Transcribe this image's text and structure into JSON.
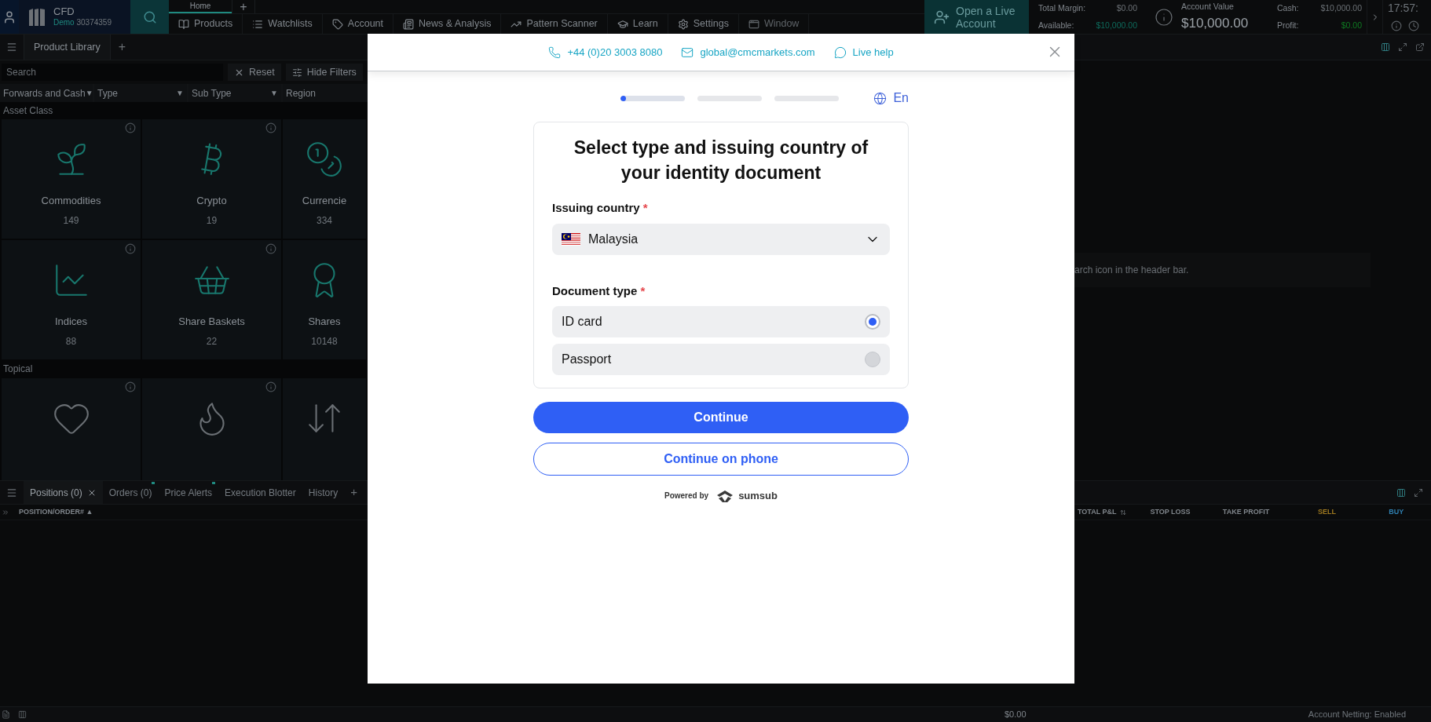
{
  "top_bar": {
    "account_type": "CFD",
    "account_label": "Demo",
    "account_number": "30374359",
    "tabs": [
      {
        "label": "Home",
        "selected": true
      }
    ],
    "add_tab": "+",
    "nav": [
      "Products",
      "Watchlists",
      "Account",
      "News & Analysis",
      "Pattern Scanner",
      "Learn",
      "Settings",
      "Window"
    ],
    "live_account": "Open a Live Account",
    "stats": [
      {
        "label": "Total Margin:",
        "value": "$0.00",
        "color": "#6b7075"
      },
      {
        "label": "Available:",
        "value": "$10,000.00",
        "color": "#0e6b5c"
      }
    ],
    "account_value": {
      "label": "Account Value",
      "value": "$10,000.00"
    },
    "balances": [
      {
        "label": "Cash:",
        "value": "$10,000.00",
        "color": "#6b7075"
      },
      {
        "label": "Profit:",
        "value": "$0.00",
        "color": "#0f7a22"
      }
    ],
    "clock": "17:57:"
  },
  "product_library": {
    "tab": "Product Library",
    "add_tab": "+",
    "search": {
      "placeholder": "Search"
    },
    "reset": "Reset",
    "hide_filters": "Hide Filters",
    "filters": [
      {
        "label": "Forwards and Cash",
        "arrow": "▼"
      },
      {
        "label": "Type",
        "arrow": "▼"
      },
      {
        "label": "Sub Type",
        "arrow": "▼"
      },
      {
        "label": "Region"
      }
    ],
    "asset_class": {
      "label": "Asset Class",
      "tiles": [
        {
          "name": "Commodities",
          "count": "149",
          "info": true
        },
        {
          "name": "Crypto",
          "count": "19",
          "info": true
        },
        {
          "name": "Currencie",
          "count": "334",
          "info": false
        },
        {
          "name": "Indices",
          "count": "88",
          "info": true
        },
        {
          "name": "Share Baskets",
          "count": "22",
          "info": true
        },
        {
          "name": "Shares",
          "count": "10148",
          "info": false
        }
      ]
    },
    "topical": {
      "label": "Topical",
      "tiles": [
        {
          "info": true
        },
        {
          "info": true
        },
        {
          "info": false
        }
      ]
    }
  },
  "right_panel": {
    "message": "arch icon in the header bar."
  },
  "positions_panel": {
    "tabs": [
      {
        "label": "Positions (0)",
        "selected": true,
        "closable": true,
        "alert": false
      },
      {
        "label": "Orders (0)",
        "selected": false,
        "closable": false,
        "alert": true
      },
      {
        "label": "Price Alerts",
        "selected": false,
        "closable": false,
        "alert": true
      },
      {
        "label": "Execution Blotter",
        "selected": false,
        "closable": false,
        "alert": false
      },
      {
        "label": "History",
        "selected": false,
        "closable": false,
        "alert": false
      }
    ],
    "add_tab": "+",
    "columns_left": [
      {
        "label": "POSITION/ORDER#",
        "sort": "▲"
      }
    ],
    "columns_right": [
      {
        "label": "TOTAL P&L",
        "kind": "sortable"
      },
      {
        "label": "STOP LOSS",
        "kind": "plain"
      },
      {
        "label": "TAKE PROFIT",
        "kind": "plain"
      },
      {
        "label": "SELL",
        "kind": "sell"
      },
      {
        "label": "BUY",
        "kind": "buy"
      }
    ]
  },
  "status_bar": {
    "total": "$0.00",
    "netting": "Account Netting: Enabled"
  },
  "modal": {
    "contacts": [
      {
        "kind": "phone",
        "text": "+44 (0)20 3003 8080"
      },
      {
        "kind": "email",
        "text": "global@cmcmarkets.com"
      },
      {
        "kind": "chat",
        "text": "Live help"
      }
    ],
    "steps": [
      {
        "current": true,
        "level": 0.08
      },
      {
        "current": false
      },
      {
        "current": false
      }
    ],
    "language": "En",
    "title": "Select type and issuing country of your identity document",
    "issuing_country": {
      "label": "Issuing country",
      "required": "*",
      "value": "Malaysia"
    },
    "document_type": {
      "label": "Document type",
      "required": "*",
      "options": [
        {
          "label": "ID card",
          "selected": true
        },
        {
          "label": "Passport",
          "selected": false
        }
      ]
    },
    "continue": "Continue",
    "continue_phone": "Continue on phone",
    "powered_by": "Powered by",
    "brand": "sumsub"
  }
}
